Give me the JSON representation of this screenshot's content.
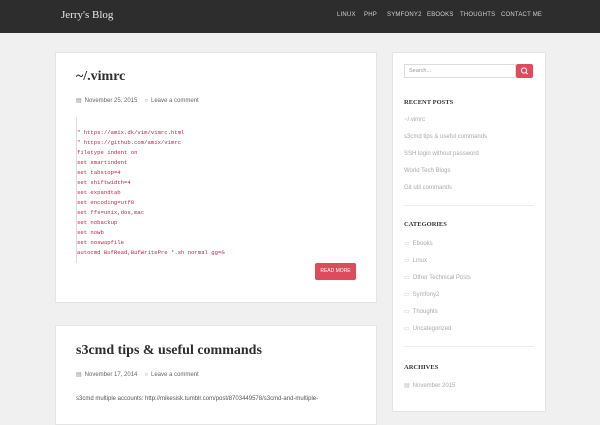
{
  "site": {
    "title": "Jerry's Blog"
  },
  "nav": {
    "items": [
      "LINUX",
      "PHP",
      "SYMFONY2",
      "EBOOKS",
      "THOUGHTS",
      "CONTACT ME"
    ]
  },
  "posts": [
    {
      "title": "~/.vimrc",
      "date": "November 25, 2015",
      "comment_link": "Leave a comment",
      "code_lines": [
        "\" https://amix.dk/vim/vimrc.html",
        "\" https://github.com/amix/vimrc",
        "filetype indent on",
        "set smartindent",
        "set tabstop=4",
        "set shiftwidth=4",
        "set expandtab",
        "set encoding=utf8",
        "set ffs=unix,dos,mac",
        "set nobackup",
        "set nowb",
        "set noswapfile",
        "autocmd BufRead,BufWritePre *.sh normal gg=G"
      ],
      "read_more": "READ MORE"
    },
    {
      "title": "s3cmd tips & useful commands",
      "date": "November 17, 2014",
      "comment_link": "Leave a comment",
      "excerpt": "s3cmd multiple accounts: http://mikesisk.tumblr.com/post/8703449578/s3cmd-and-multiple-"
    }
  ],
  "sidebar": {
    "search_placeholder": "Search...",
    "search_icon": "search-icon",
    "recent_posts_title": "RECENT POSTS",
    "recent_posts": [
      "~/.vimrc",
      "s3cmd tips & useful commands",
      "SSH login without password",
      "World Tech Blogs",
      "Git util commands"
    ],
    "categories_title": "CATEGORIES",
    "categories": [
      "Ebooks",
      "Linux",
      "Other Technical Posts",
      "Symfony2",
      "Thoughts",
      "Uncategorized"
    ],
    "archives_title": "ARCHIVES",
    "archives": [
      "November 2015"
    ]
  },
  "colors": {
    "accent": "#dd4b5c",
    "navbar": "#2d2d2d",
    "code": "#c7254e",
    "background": "#f0f0f0"
  }
}
